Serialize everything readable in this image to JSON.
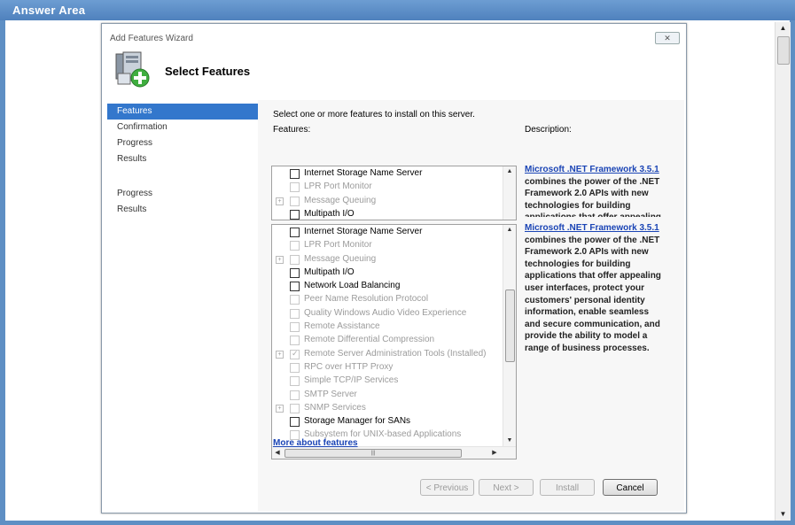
{
  "answer_area": {
    "title": "Answer Area"
  },
  "wizard": {
    "title": "Add Features Wizard",
    "heading": "Select Features",
    "nav": [
      {
        "label": "Features",
        "active": true
      },
      {
        "label": "Confirmation"
      },
      {
        "label": "Progress"
      },
      {
        "label": "Results"
      }
    ],
    "nav2": [
      {
        "label": "Progress"
      },
      {
        "label": "Results"
      }
    ],
    "instruction": "Select one or more features to install on this server.",
    "features_label": "Features:",
    "description_label": "Description:",
    "description_link": "Microsoft .NET Framework 3.5.1",
    "description_text": "combines the power of the .NET Framework 2.0 APIs with new technologies for building applications that offer appealing",
    "description_link_2": "Microsoft .NET Framework 3.5.1",
    "description_text_2": "combines the power of the .NET Framework 2.0 APIs with new technologies for building applications that offer appealing user interfaces, protect your customers' personal identity information, enable seamless and secure communication, and provide the ability to model a range of business processes.",
    "list_small": [
      {
        "label": "Internet Storage Name Server",
        "enabled": true
      },
      {
        "label": "LPR Port Monitor",
        "enabled": false
      },
      {
        "label": "Message Queuing",
        "enabled": false,
        "expander": true
      },
      {
        "label": "Multipath I/O",
        "enabled": true
      }
    ],
    "list_large": [
      {
        "label": "Internet Storage Name Server",
        "enabled": true
      },
      {
        "label": "LPR Port Monitor",
        "enabled": false
      },
      {
        "label": "Message Queuing",
        "enabled": false,
        "expander": true
      },
      {
        "label": "Multipath I/O",
        "enabled": true
      },
      {
        "label": "Network Load Balancing",
        "enabled": true
      },
      {
        "label": "Peer Name Resolution Protocol",
        "enabled": false
      },
      {
        "label": "Quality Windows Audio Video Experience",
        "enabled": false
      },
      {
        "label": "Remote Assistance",
        "enabled": false
      },
      {
        "label": "Remote Differential Compression",
        "enabled": false
      },
      {
        "label": "Remote Server Administration Tools  (Installed)",
        "enabled": false,
        "expander": true,
        "checked": true
      },
      {
        "label": "RPC over HTTP Proxy",
        "enabled": false
      },
      {
        "label": "Simple TCP/IP Services",
        "enabled": false
      },
      {
        "label": "SMTP Server",
        "enabled": false
      },
      {
        "label": "SNMP Services",
        "enabled": false,
        "expander": true
      },
      {
        "label": "Storage Manager for SANs",
        "enabled": true
      },
      {
        "label": "Subsystem for UNIX-based Applications",
        "enabled": false
      }
    ],
    "more_link": "More about features",
    "buttons": {
      "previous": "< Previous",
      "next": "Next >",
      "install": "Install",
      "cancel": "Cancel"
    }
  }
}
